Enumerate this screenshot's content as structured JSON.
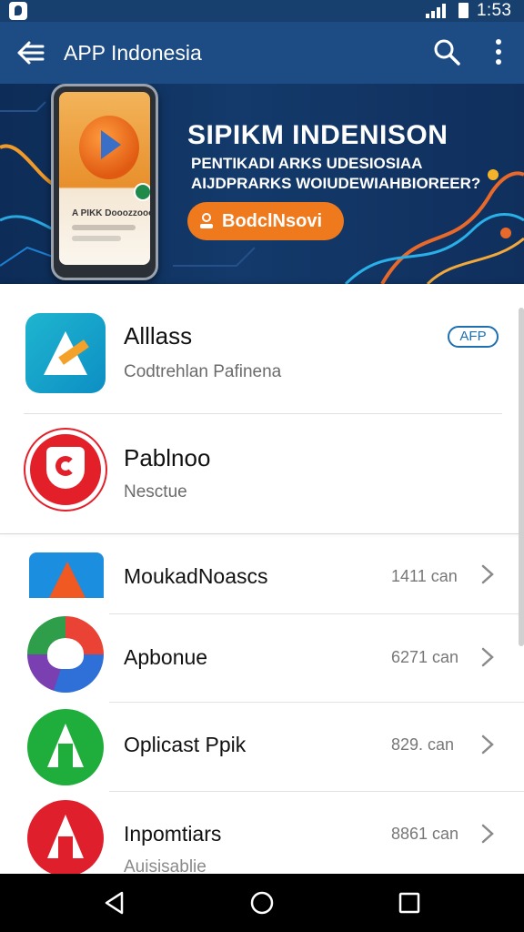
{
  "status_bar": {
    "time": "1:53"
  },
  "app_bar": {
    "title": "APP Indonesia"
  },
  "banner": {
    "phone_line": "A PIKK Dooozzooo",
    "headline": "SIPIKM INDENISON",
    "subline1": "PENTIKADI ARKS UDESIOSIAA",
    "subline2": "AIJDPRARKS WOIUDEWIAHBIOREER?",
    "button_label": "BodclNsovi",
    "button_color": "#ef7a1e"
  },
  "featured": [
    {
      "title": "Alllass",
      "subtitle": "Codtrehlan Pafinena",
      "badge": "AFP"
    },
    {
      "title": "Pablnoo",
      "subtitle": "Nesctue"
    }
  ],
  "list": [
    {
      "title": "MoukadNoascs",
      "size": "1411 can"
    },
    {
      "title": "Apbonue",
      "size": "6271 can"
    },
    {
      "title": "Oplicast Ppik",
      "size": "829. can"
    },
    {
      "title": "Inpomtiars",
      "size": "8861 can",
      "subtitle": "Auisisablie"
    }
  ],
  "colors": {
    "app_bar": "#1d4c84",
    "status_bar": "#17406f",
    "accent": "#1d6fb0"
  }
}
